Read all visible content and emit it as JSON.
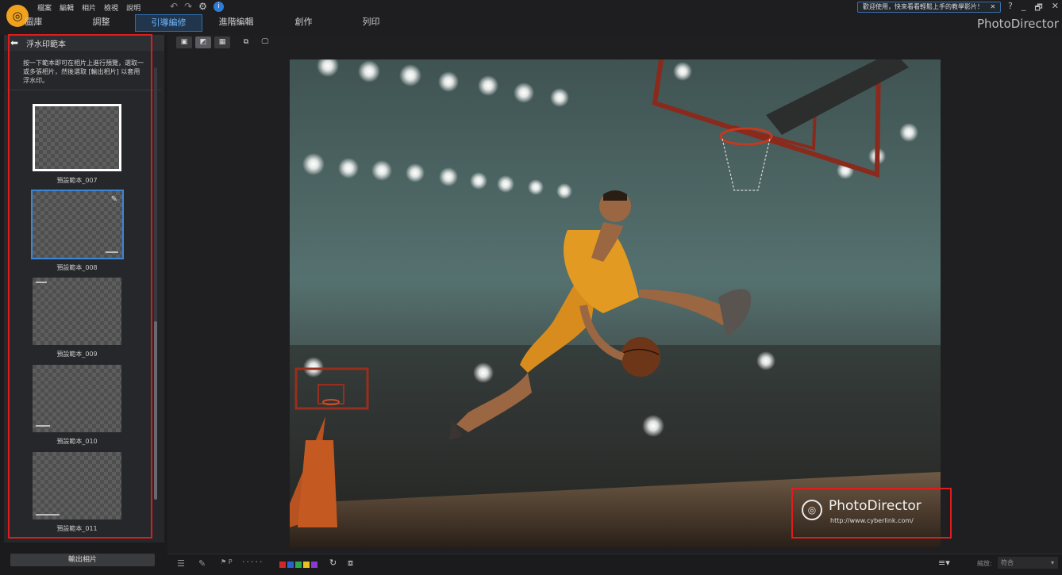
{
  "menu": [
    "檔案",
    "編輯",
    "相片",
    "檢視",
    "說明"
  ],
  "tabs": [
    {
      "label": "圖庫"
    },
    {
      "label": "調整"
    },
    {
      "label": "引導編修"
    },
    {
      "label": "進階編輯"
    },
    {
      "label": "創作"
    },
    {
      "label": "列印"
    }
  ],
  "active_tab": "引導編修",
  "welcome_text": "歡迎使用，快來看看輕鬆上手的教學影片！",
  "welcome_close": "✕",
  "window_controls": [
    "?",
    "_",
    "🗗",
    "✕"
  ],
  "brand": "PhotoDirector",
  "panel": {
    "title": "浮水印範本",
    "description": "按一下範本即可在相片上進行預覽，選取一或多張相片，然後選取 [輸出相片] 以套用浮水印。",
    "templates": [
      "預設範本_007",
      "預設範本_008",
      "預設範本_009",
      "預設範本_010",
      "預設範本_011"
    ],
    "export_button": "輸出相片"
  },
  "watermark": {
    "title": "PhotoDirector",
    "url": "http://www.cyberlink.com/"
  },
  "zoom": {
    "label": "縮放:",
    "value": "符合"
  },
  "colors": {
    "accent": "#3d86d6",
    "highlight": "#e01c1c",
    "logo": "#f0a21c"
  },
  "icons": [
    "logo-icon",
    "undo-icon",
    "redo-icon",
    "settings-icon",
    "info-icon",
    "back-arrow-icon",
    "pen-icon",
    "rotate-icon",
    "compare-icon",
    "flag-icon",
    "menu-icon"
  ]
}
